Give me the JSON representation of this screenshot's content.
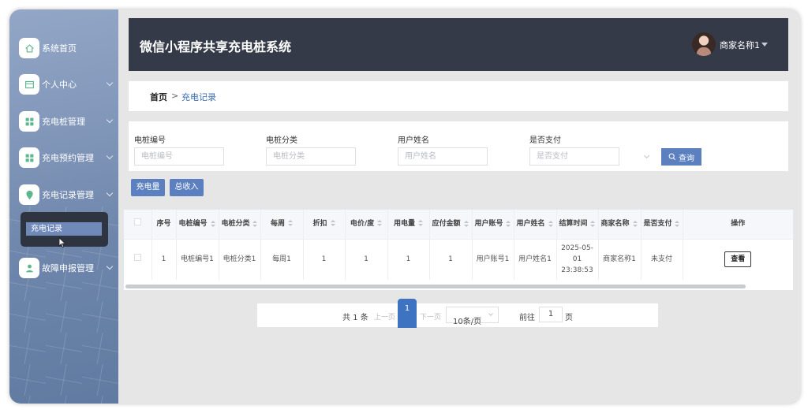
{
  "app": {
    "title": "微信小程序共享充电桩系统"
  },
  "header": {
    "user_name": "商家名称1"
  },
  "sidebar": {
    "items": [
      {
        "label": "系统首页",
        "icon": "home-icon",
        "expandable": false
      },
      {
        "label": "个人中心",
        "icon": "profile-card-icon",
        "expandable": true
      },
      {
        "label": "充电桩管理",
        "icon": "grid-icon",
        "expandable": true
      },
      {
        "label": "充电预约管理",
        "icon": "grid-icon",
        "expandable": true
      },
      {
        "label": "充电记录管理",
        "icon": "location-pin-icon",
        "expandable": true
      },
      {
        "label": "故障申报管理",
        "icon": "user-icon",
        "expandable": true
      }
    ],
    "submenu": {
      "active_label": "充电记录"
    }
  },
  "breadcrumb": {
    "home": "首页",
    "separator": ">",
    "current": "充电记录"
  },
  "search": {
    "fields": [
      {
        "label": "电桩编号",
        "placeholder": "电桩编号"
      },
      {
        "label": "电桩分类",
        "placeholder": "电桩分类"
      },
      {
        "label": "用户姓名",
        "placeholder": "用户姓名"
      },
      {
        "label": "是否支付",
        "placeholder": "是否支付"
      }
    ],
    "button_label": "查询"
  },
  "actions": {
    "charge_amount": "充电量",
    "total_income": "总收入"
  },
  "table": {
    "headers": [
      "序号",
      "电桩编号",
      "电桩分类",
      "每周",
      "折扣",
      "电价/度",
      "用电量",
      "应付金额",
      "用户账号",
      "用户姓名",
      "结算时间",
      "商家名称",
      "是否支付",
      "操作"
    ],
    "rows": [
      [
        "1",
        "电桩编号1",
        "电桩分类1",
        "每周1",
        "1",
        "1",
        "1",
        "1",
        "用户账号1",
        "用户姓名1",
        "2025-05-01 23:38:53",
        "商家名称1",
        "未支付",
        "查看"
      ]
    ]
  },
  "pagination": {
    "total_text": "共 1 条",
    "prev": "上一页",
    "current_page": "1",
    "next": "下一页",
    "page_size": "10条/页",
    "goto_prefix": "前往",
    "goto_value": "1",
    "goto_suffix": "页"
  },
  "colors": {
    "accent": "#5b7fbf",
    "header_bg": "#343a48",
    "active_page": "#3e73c2"
  }
}
